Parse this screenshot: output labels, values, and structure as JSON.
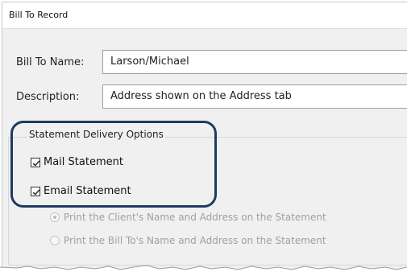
{
  "window": {
    "title": "Bill To Record"
  },
  "form": {
    "bill_to_name_label": "Bill To Name:",
    "bill_to_name_value": "Larson/Michael",
    "description_label": "Description:",
    "description_value": "Address shown on the Address tab"
  },
  "statement_delivery": {
    "group_title": "Statement Delivery Options",
    "mail_statement": {
      "label": "Mail Statement",
      "checked": true
    },
    "email_statement": {
      "label": "Email Statement",
      "checked": true
    },
    "print_options": [
      {
        "label": "Print the Client's Name and Address on the Statement",
        "selected": true,
        "enabled": false
      },
      {
        "label": "Print the Bill To's Name and Address on the Statement",
        "selected": false,
        "enabled": false
      }
    ]
  },
  "colors": {
    "highlight_border": "#1f3b63",
    "dialog_background": "#f0f0f0",
    "disabled_text": "#a0a0a0"
  }
}
